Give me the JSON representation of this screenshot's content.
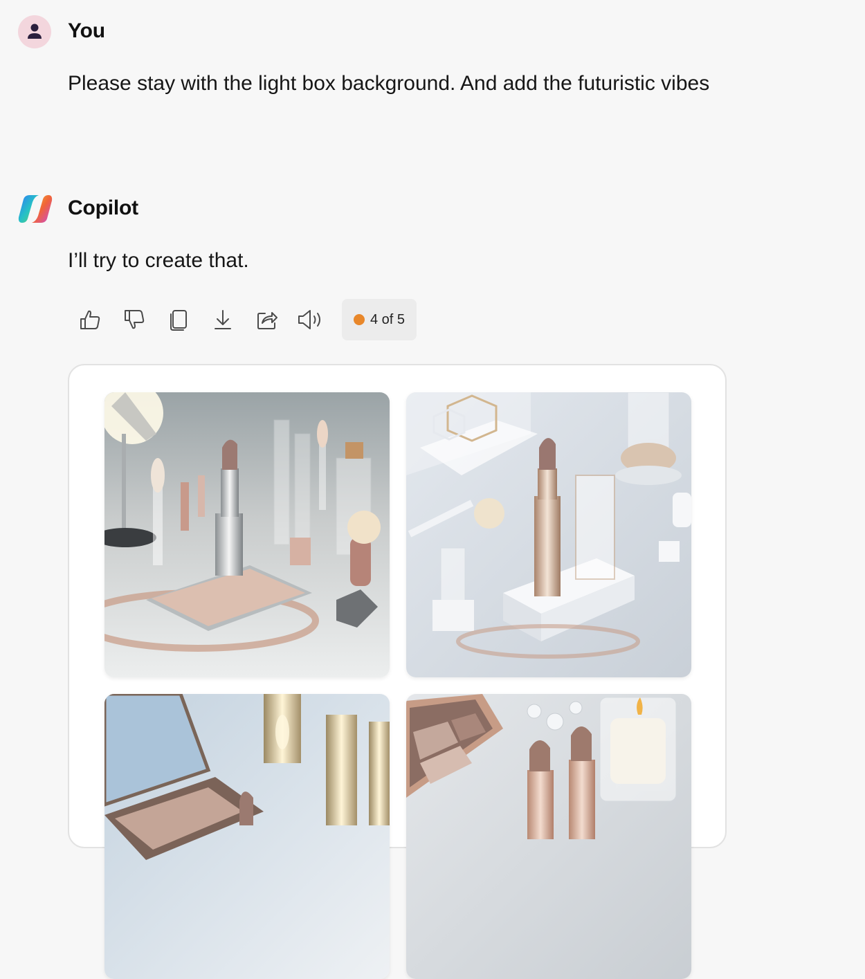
{
  "user_message": {
    "author": "You",
    "text": "Please stay with the light box background. And add the futuristic vibes"
  },
  "bot_message": {
    "author": "Copilot",
    "text": "I’ll try to create that."
  },
  "toolbar": {
    "icons": [
      "thumbs-up-icon",
      "thumbs-down-icon",
      "copy-icon",
      "download-icon",
      "share-icon",
      "read-aloud-icon"
    ],
    "pager_label": "4 of 5",
    "pager_color": "#e8872a"
  },
  "gallery": {
    "images": [
      "lipstick on mirrored tray with studio lamp",
      "lipstick on white pedestal with geometric props",
      "open compact with metallic lipstick tubes",
      "eyeshadow palette with lipsticks and candle"
    ]
  }
}
